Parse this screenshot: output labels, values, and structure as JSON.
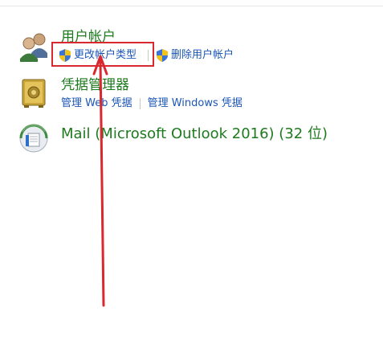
{
  "user_accounts": {
    "title": "用户帐户",
    "icon": "users-icon",
    "links": {
      "change_type": "更改帐户类型",
      "delete": "删除用户帐户"
    }
  },
  "credential_manager": {
    "title": "凭据管理器",
    "icon": "vault-icon",
    "links": {
      "web": "管理 Web 凭据",
      "windows": "管理 Windows 凭据"
    }
  },
  "mail": {
    "title": "Mail (Microsoft Outlook 2016) (32 位)",
    "icon": "mail-icon"
  },
  "colors": {
    "title_green": "#1e7a1e",
    "link_blue": "#1a56b8",
    "annotation_red": "#d9282e"
  }
}
